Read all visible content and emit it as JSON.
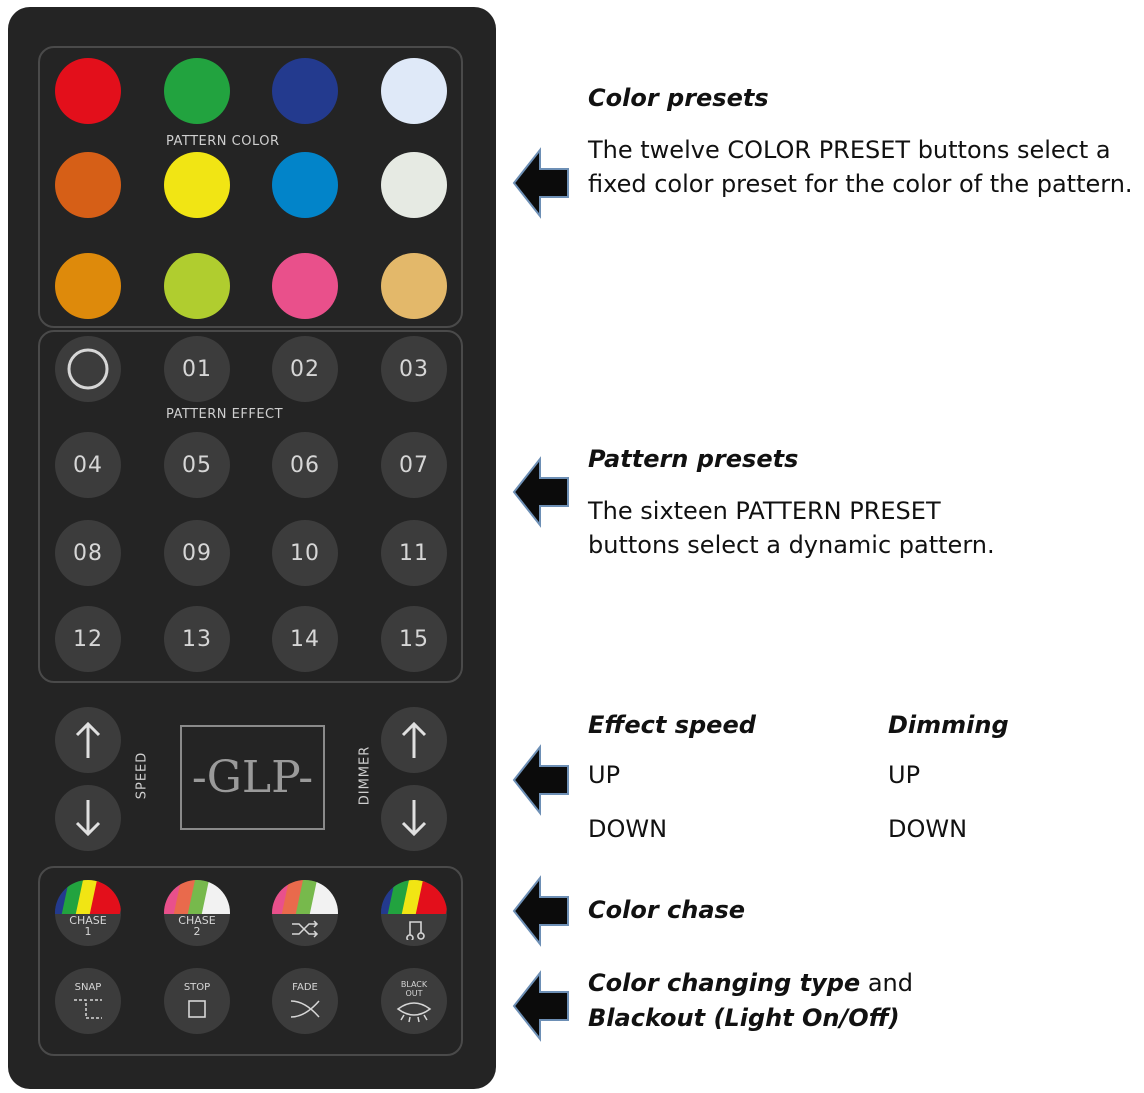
{
  "remote": {
    "pattern_color_label": "PATTERN COLOR",
    "pattern_effect_label": "PATTERN EFFECT",
    "speed_label": "SPEED",
    "dimmer_label": "DIMMER",
    "logo_text": "-GLP-",
    "color_buttons": [
      "#e30f1b",
      "#22a33f",
      "#233a8e",
      "#dfe9f8",
      "#d65f17",
      "#f1e514",
      "#0284c9",
      "#e6eae3",
      "#de8a0b",
      "#b0cd2f",
      "#e9508b",
      "#e3b86a"
    ],
    "pattern_buttons": [
      "01",
      "02",
      "03",
      "04",
      "05",
      "06",
      "07",
      "08",
      "09",
      "10",
      "11",
      "12",
      "13",
      "14",
      "15"
    ],
    "chase_buttons": [
      "CHASE 1",
      "CHASE 2",
      "RANDOM",
      "MUSIC"
    ],
    "chase_labels": {
      "chase1_a": "CHASE",
      "chase1_b": "1",
      "chase2_a": "CHASE",
      "chase2_b": "2"
    },
    "mode_buttons": {
      "snap": "SNAP",
      "stop": "STOP",
      "fade": "FADE",
      "blackout": "BLACK OUT"
    }
  },
  "annotations": {
    "color_presets_title": "Color presets",
    "color_presets_text": "The twelve COLOR PRESET buttons select a fixed color preset for the color of the pattern.",
    "pattern_presets_title": "Pattern presets",
    "pattern_presets_text": "The sixteen PATTERN PRESET buttons select a dynamic pattern.",
    "effect_speed_title": "Effect speed",
    "dimming_title": "Dimming",
    "speed_up": "UP",
    "speed_down": "DOWN",
    "dim_up": "UP",
    "dim_down": "DOWN",
    "color_chase_title": "Color chase",
    "changing_type_title": "Color changing type",
    "changing_type_and": " and",
    "blackout_title": "Blackout (Light On/Off)"
  }
}
